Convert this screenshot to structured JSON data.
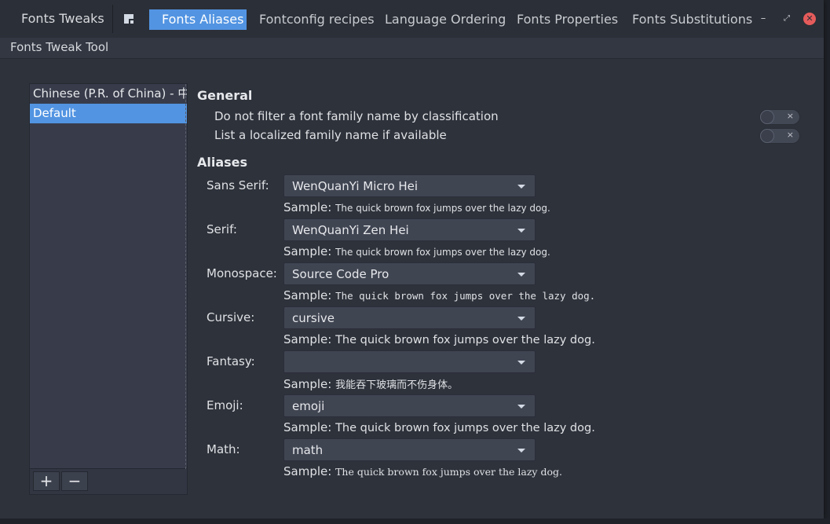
{
  "header": {
    "app_title": "Fonts Tweaks",
    "tabs": [
      {
        "label": "Fonts Aliases",
        "active": true
      },
      {
        "label": "Fontconfig recipes",
        "active": false
      },
      {
        "label": "Language Ordering",
        "active": false
      },
      {
        "label": "Fonts Properties",
        "active": false
      },
      {
        "label": "Fonts Substitutions",
        "active": false
      }
    ],
    "minimize": "–",
    "maximize": "⤢",
    "close": "✕"
  },
  "subtitle": "Fonts Tweak Tool",
  "languages": {
    "items": [
      {
        "label": "Chinese (P.R. of China) - 中文"
      },
      {
        "label": "Default",
        "selected": true
      }
    ],
    "add_label": "+",
    "remove_label": "−"
  },
  "general": {
    "title": "General",
    "options": [
      {
        "label": "Do not filter a font family name by classification",
        "enabled": false
      },
      {
        "label": "List a localized family name if available",
        "enabled": false
      }
    ],
    "switch_off_mark": "×"
  },
  "aliases": {
    "title": "Aliases",
    "sample_prefix": "Sample:",
    "rows": [
      {
        "label": "Sans Serif:",
        "value": "WenQuanYi Micro Hei",
        "sample": "The quick brown fox jumps over the lazy dog."
      },
      {
        "label": "Serif:",
        "value": "WenQuanYi Zen Hei",
        "sample": "The quick brown fox jumps over the lazy dog."
      },
      {
        "label": "Monospace:",
        "value": "Source Code Pro",
        "sample": "The quick brown fox jumps over the lazy dog."
      },
      {
        "label": "Cursive:",
        "value": "cursive",
        "sample": "The quick brown fox jumps over the lazy dog."
      },
      {
        "label": "Fantasy:",
        "value": "",
        "sample": "我能吞下玻璃而不伤身体。"
      },
      {
        "label": "Emoji:",
        "value": "emoji",
        "sample": "The quick brown fox jumps over the lazy dog."
      },
      {
        "label": "Math:",
        "value": "math",
        "sample": "The quick brown fox jumps over the lazy dog."
      }
    ]
  },
  "colors": {
    "accent": "#5294e2",
    "window_bg": "#2e323b",
    "close": "#e55b5b"
  }
}
